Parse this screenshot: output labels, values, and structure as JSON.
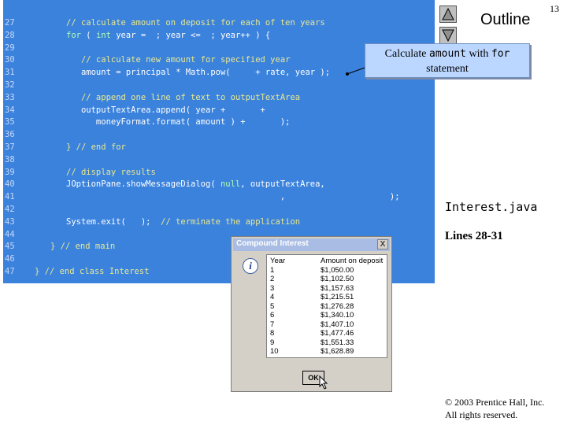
{
  "slide": {
    "number": "13",
    "outline_title": "Outline"
  },
  "code": {
    "lines": [
      {
        "num": "27",
        "segments": [
          {
            "t": "// calculate amount on deposit for each of ten years",
            "c": "cm"
          }
        ]
      },
      {
        "num": "28",
        "segments": [
          {
            "t": "for",
            "c": "kw"
          },
          {
            "t": " ( ",
            "c": ""
          },
          {
            "t": "int",
            "c": "kw"
          },
          {
            "t": " year = ",
            "c": ""
          },
          {
            "t": " ; year <= ",
            "c": ""
          },
          {
            "t": " ; year++ ) {",
            "c": ""
          }
        ]
      },
      {
        "num": "29",
        "segments": []
      },
      {
        "num": "30",
        "segments": [
          {
            "t": "   // calculate new amount for specified year",
            "c": "cm"
          }
        ]
      },
      {
        "num": "31",
        "segments": [
          {
            "t": "   amount = principal * Math.pow( ",
            "c": ""
          },
          {
            "t": "    + rate, year );",
            "c": ""
          }
        ]
      },
      {
        "num": "32",
        "segments": []
      },
      {
        "num": "33",
        "segments": [
          {
            "t": "   // append one line of text to outputTextArea",
            "c": "cm"
          }
        ]
      },
      {
        "num": "34",
        "segments": [
          {
            "t": "   outputTextArea.append( year + ",
            "c": ""
          },
          {
            "t": "      +",
            "c": ""
          }
        ]
      },
      {
        "num": "35",
        "segments": [
          {
            "t": "      moneyFormat.format( amount ) + ",
            "c": ""
          },
          {
            "t": "      );",
            "c": ""
          }
        ]
      },
      {
        "num": "36",
        "segments": []
      },
      {
        "num": "37",
        "segments": [
          {
            "t": "} // end for",
            "c": "cm"
          }
        ]
      },
      {
        "num": "38",
        "segments": []
      },
      {
        "num": "39",
        "segments": [
          {
            "t": "// display results",
            "c": "cm"
          }
        ]
      },
      {
        "num": "40",
        "segments": [
          {
            "t": "JOptionPane.showMessageDialog( ",
            "c": ""
          },
          {
            "t": "null",
            "c": "kw"
          },
          {
            "t": ", outputTextArea,",
            "c": ""
          }
        ]
      },
      {
        "num": "41",
        "segments": [
          {
            "t": "                                           ,",
            "c": ""
          },
          {
            "t": "                     );",
            "c": ""
          }
        ]
      },
      {
        "num": "42",
        "segments": []
      },
      {
        "num": "43",
        "segments": [
          {
            "t": "System.exit( ",
            "c": ""
          },
          {
            "t": "  );  ",
            "c": ""
          },
          {
            "t": "// terminate the application",
            "c": "cm"
          }
        ]
      },
      {
        "num": "44",
        "segments": []
      },
      {
        "num": "45",
        "segments": [
          {
            "t": "} // end main",
            "c": "cm"
          }
        ]
      },
      {
        "num": "46",
        "segments": []
      },
      {
        "num": "47",
        "segments": [
          {
            "t": "} // end class Interest",
            "c": "cm"
          }
        ]
      }
    ]
  },
  "callout": {
    "prefix": "Calculate ",
    "code1": "amount",
    "mid": " with ",
    "code2": "for",
    "line2": "statement"
  },
  "sidebar": {
    "filename": "Interest.java",
    "lines_label": "Lines 28-31"
  },
  "copyright": {
    "line1": "© 2003 Prentice Hall, Inc.",
    "line2": "All rights reserved."
  },
  "dialog": {
    "title": "Compound Interest",
    "close_label": "X",
    "icon_glyph": "i",
    "header_year": "Year",
    "header_amount": "Amount on deposit",
    "rows": [
      {
        "year": "1",
        "amount": "$1,050.00"
      },
      {
        "year": "2",
        "amount": "$1,102.50"
      },
      {
        "year": "3",
        "amount": "$1,157.63"
      },
      {
        "year": "4",
        "amount": "$1,215.51"
      },
      {
        "year": "5",
        "amount": "$1,276.28"
      },
      {
        "year": "6",
        "amount": "$1,340.10"
      },
      {
        "year": "7",
        "amount": "$1,407.10"
      },
      {
        "year": "8",
        "amount": "$1,477.46"
      },
      {
        "year": "9",
        "amount": "$1,551.33"
      },
      {
        "year": "10",
        "amount": "$1,628.89"
      }
    ],
    "ok_label": "OK"
  },
  "colors": {
    "code_bg": "#3b82dd",
    "comment": "#e8e890",
    "keyword": "#b2ffb2",
    "callout_bg": "#bcd7ff"
  }
}
